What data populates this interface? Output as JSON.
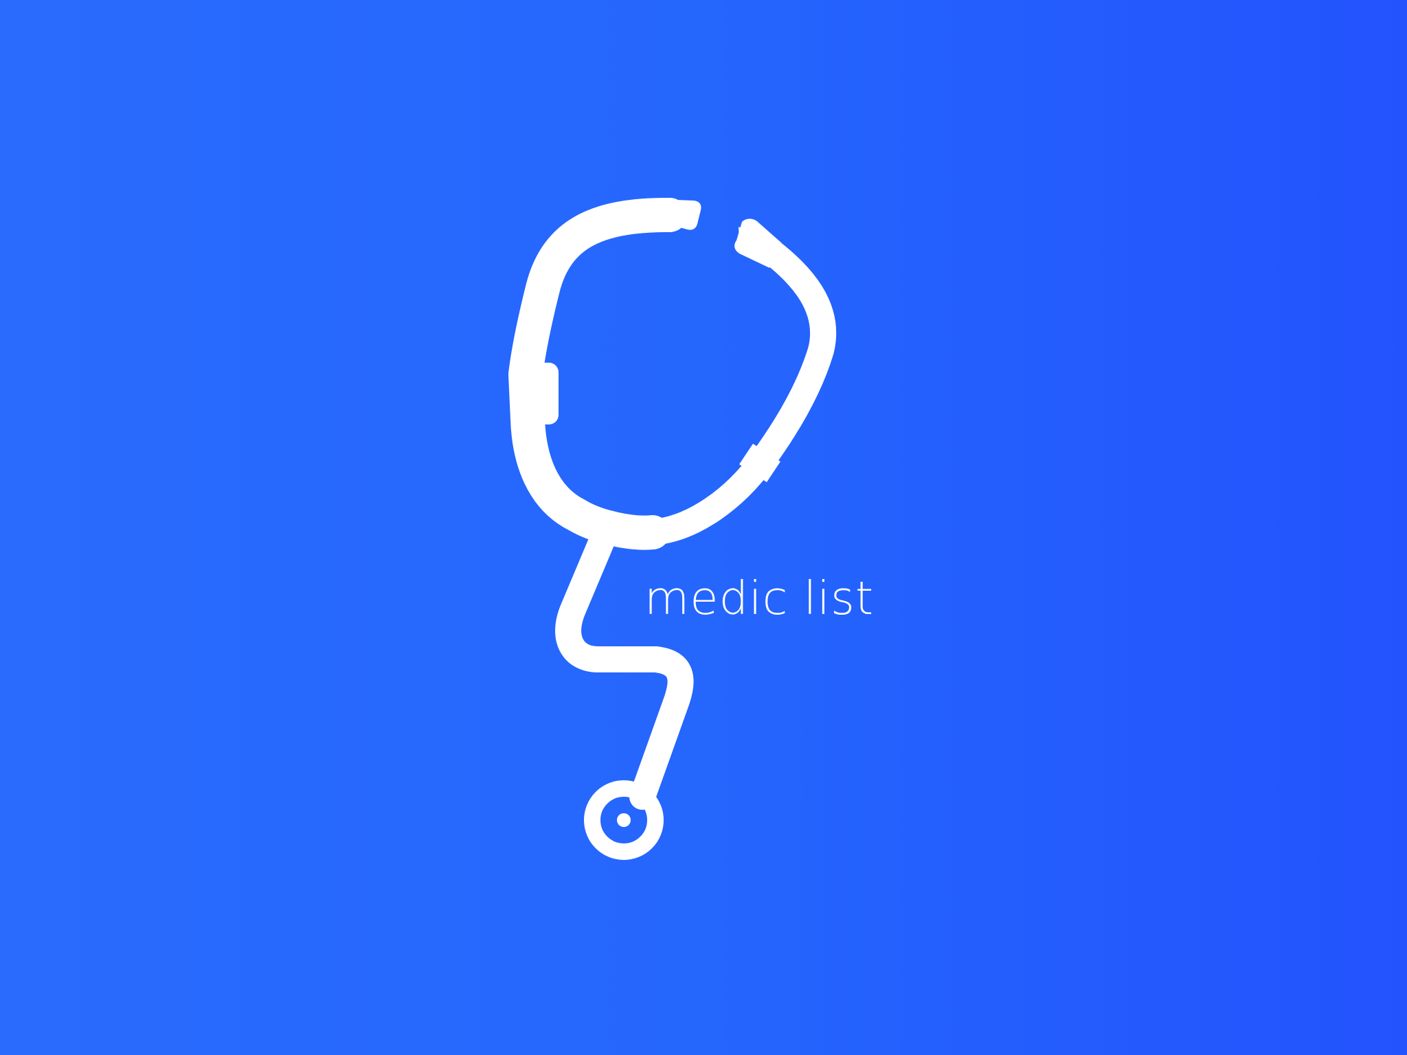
{
  "splash": {
    "brand_name": "medic list",
    "logo_icon": "stethoscope-icon",
    "colors": {
      "background_start": "#2a6bfd",
      "background_end": "#2353fd",
      "foreground": "#ffffff"
    }
  }
}
